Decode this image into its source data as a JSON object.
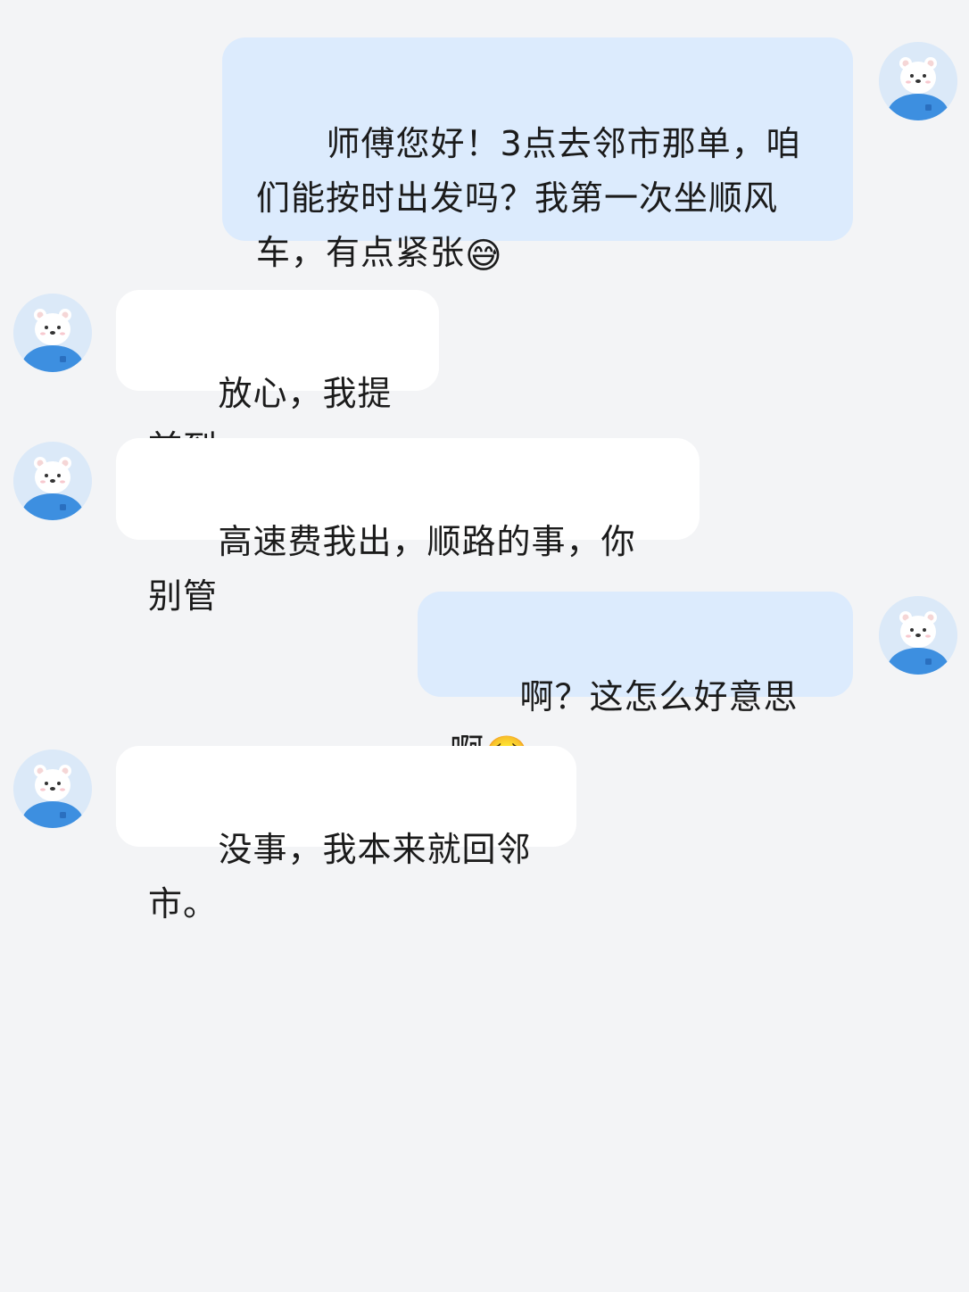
{
  "avatar_icon": "polar-bear-avatar-icon",
  "colors": {
    "background": "#f3f4f6",
    "my_bubble": "#dcebfd",
    "their_bubble": "#ffffff",
    "avatar_shirt": "#3d8fe0"
  },
  "messages": [
    {
      "sender": "me",
      "text": "师傅您好！3点去邻市那单，咱们能按时出发吗？我第一次坐顺风车，有点紧张",
      "emoji": "😅"
    },
    {
      "sender": "driver",
      "text": "放心，我提前到",
      "emoji": ""
    },
    {
      "sender": "driver",
      "text": "高速费我出，顺路的事，你别管",
      "emoji": ""
    },
    {
      "sender": "me",
      "text": "啊？这怎么好意思啊",
      "emoji": "🥺"
    },
    {
      "sender": "driver",
      "text": "没事，我本来就回邻市。",
      "emoji": ""
    }
  ]
}
